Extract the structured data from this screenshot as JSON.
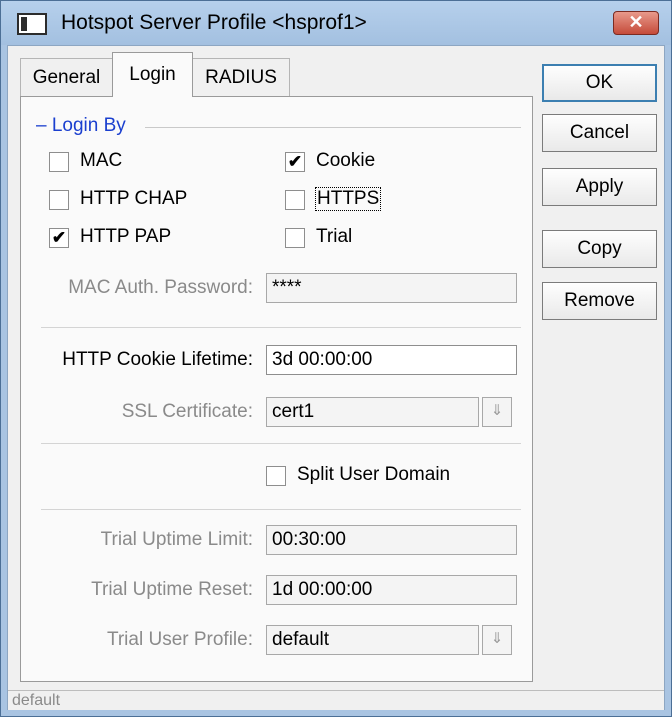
{
  "window": {
    "title": "Hotspot Server Profile <hsprof1>",
    "close_glyph": "✕"
  },
  "tabs": [
    {
      "label": "General",
      "active": false
    },
    {
      "label": "Login",
      "active": true
    },
    {
      "label": "RADIUS",
      "active": false
    }
  ],
  "login_by": {
    "legend": "– Login By",
    "options": {
      "mac": {
        "label": "MAC",
        "checked": false
      },
      "cookie": {
        "label": "Cookie",
        "checked": true
      },
      "http_chap": {
        "label": "HTTP CHAP",
        "checked": false
      },
      "https": {
        "label": "HTTPS",
        "checked": false
      },
      "http_pap": {
        "label": "HTTP PAP",
        "checked": true
      },
      "trial": {
        "label": "Trial",
        "checked": false
      }
    },
    "check_glyph": "✔"
  },
  "fields": {
    "mac_auth_password": {
      "label": "MAC Auth. Password:",
      "value": "****"
    },
    "http_cookie_lifetime": {
      "label": "HTTP Cookie Lifetime:",
      "value": "3d 00:00:00"
    },
    "ssl_certificate": {
      "label": "SSL Certificate:",
      "value": "cert1"
    },
    "split_user_domain": {
      "label": "Split User Domain",
      "checked": false
    },
    "trial_uptime_limit": {
      "label": "Trial Uptime Limit:",
      "value": "00:30:00"
    },
    "trial_uptime_reset": {
      "label": "Trial Uptime Reset:",
      "value": "1d 00:00:00"
    },
    "trial_user_profile": {
      "label": "Trial User Profile:",
      "value": "default"
    }
  },
  "dropdown_glyph": "⇓",
  "buttons": {
    "ok": "OK",
    "cancel": "Cancel",
    "apply": "Apply",
    "copy": "Copy",
    "remove": "Remove"
  },
  "status": {
    "text": "default"
  },
  "colors": {
    "title_bar": "#a9c4e2",
    "group_legend": "#1a3fcf",
    "close_button": "#c54b3a"
  }
}
